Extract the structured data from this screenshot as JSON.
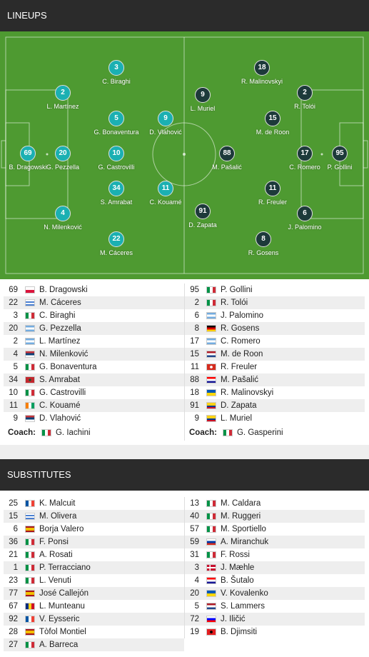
{
  "lineups_header": "LINEUPS",
  "substitutes_header": "SUBSTITUTES",
  "colors": {
    "home": "#1bb0b2",
    "away": "#1d3a3a",
    "pitch": "#4e9a31"
  },
  "pitch_players": [
    {
      "num": "69",
      "name": "B. Dragowski",
      "team": "home"
    },
    {
      "num": "20",
      "name": "G. Pezzella",
      "team": "home"
    },
    {
      "num": "2",
      "name": "L. Martínez",
      "team": "home"
    },
    {
      "num": "4",
      "name": "N. Milenković",
      "team": "home"
    },
    {
      "num": "3",
      "name": "C. Biraghi",
      "team": "home"
    },
    {
      "num": "5",
      "name": "G. Bonaventura",
      "team": "home"
    },
    {
      "num": "10",
      "name": "G. Castrovilli",
      "team": "home"
    },
    {
      "num": "34",
      "name": "S. Amrabat",
      "team": "home"
    },
    {
      "num": "22",
      "name": "M. Cáceres",
      "team": "home"
    },
    {
      "num": "9",
      "name": "D. Vlahović",
      "team": "home"
    },
    {
      "num": "11",
      "name": "C. Kouamé",
      "team": "home"
    },
    {
      "num": "95",
      "name": "P. Gollini",
      "team": "away"
    },
    {
      "num": "17",
      "name": "C. Romero",
      "team": "away"
    },
    {
      "num": "2",
      "name": "R. Tolói",
      "team": "away"
    },
    {
      "num": "6",
      "name": "J. Palomino",
      "team": "away"
    },
    {
      "num": "18",
      "name": "R. Malinovskyi",
      "team": "away"
    },
    {
      "num": "15",
      "name": "M. de Roon",
      "team": "away"
    },
    {
      "num": "11",
      "name": "R. Freuler",
      "team": "away"
    },
    {
      "num": "8",
      "name": "R. Gosens",
      "team": "away"
    },
    {
      "num": "9",
      "name": "L. Muriel",
      "team": "away"
    },
    {
      "num": "88",
      "name": "M. Pašalić",
      "team": "away"
    },
    {
      "num": "91",
      "name": "D. Zapata",
      "team": "away"
    }
  ],
  "home_lineup": [
    {
      "num": "69",
      "name": "B. Dragowski",
      "flag": "poland"
    },
    {
      "num": "22",
      "name": "M. Cáceres",
      "flag": "uruguay"
    },
    {
      "num": "3",
      "name": "C. Biraghi",
      "flag": "italy"
    },
    {
      "num": "20",
      "name": "G. Pezzella",
      "flag": "argentina"
    },
    {
      "num": "2",
      "name": "L. Martínez",
      "flag": "argentina"
    },
    {
      "num": "4",
      "name": "N. Milenković",
      "flag": "serbia"
    },
    {
      "num": "5",
      "name": "G. Bonaventura",
      "flag": "italy"
    },
    {
      "num": "34",
      "name": "S. Amrabat",
      "flag": "morocco"
    },
    {
      "num": "10",
      "name": "G. Castrovilli",
      "flag": "italy"
    },
    {
      "num": "11",
      "name": "C. Kouamé",
      "flag": "ivory-coast"
    },
    {
      "num": "9",
      "name": "D. Vlahović",
      "flag": "serbia"
    }
  ],
  "away_lineup": [
    {
      "num": "95",
      "name": "P. Gollini",
      "flag": "italy"
    },
    {
      "num": "2",
      "name": "R. Tolói",
      "flag": "italy"
    },
    {
      "num": "6",
      "name": "J. Palomino",
      "flag": "argentina"
    },
    {
      "num": "8",
      "name": "R. Gosens",
      "flag": "germany"
    },
    {
      "num": "17",
      "name": "C. Romero",
      "flag": "argentina"
    },
    {
      "num": "15",
      "name": "M. de Roon",
      "flag": "netherlands"
    },
    {
      "num": "11",
      "name": "R. Freuler",
      "flag": "switzerland"
    },
    {
      "num": "88",
      "name": "M. Pašalić",
      "flag": "croatia"
    },
    {
      "num": "18",
      "name": "R. Malinovskyi",
      "flag": "ukraine"
    },
    {
      "num": "91",
      "name": "D. Zapata",
      "flag": "colombia"
    },
    {
      "num": "9",
      "name": "L. Muriel",
      "flag": "colombia"
    }
  ],
  "home_coach": {
    "label": "Coach:",
    "name": "G. Iachini",
    "flag": "italy"
  },
  "away_coach": {
    "label": "Coach:",
    "name": "G. Gasperini",
    "flag": "italy"
  },
  "home_subs": [
    {
      "num": "25",
      "name": "K. Malcuit",
      "flag": "france"
    },
    {
      "num": "15",
      "name": "M. Olivera",
      "flag": "uruguay"
    },
    {
      "num": "6",
      "name": "Borja Valero",
      "flag": "spain"
    },
    {
      "num": "36",
      "name": "F. Ponsi",
      "flag": "italy"
    },
    {
      "num": "21",
      "name": "A. Rosati",
      "flag": "italy"
    },
    {
      "num": "1",
      "name": "P. Terracciano",
      "flag": "italy"
    },
    {
      "num": "23",
      "name": "L. Venuti",
      "flag": "italy"
    },
    {
      "num": "77",
      "name": "José Callejón",
      "flag": "spain"
    },
    {
      "num": "67",
      "name": "L. Munteanu",
      "flag": "romania"
    },
    {
      "num": "92",
      "name": "V. Eysseric",
      "flag": "france"
    },
    {
      "num": "28",
      "name": "Tòfol Montiel",
      "flag": "spain"
    },
    {
      "num": "27",
      "name": "A. Barreca",
      "flag": "italy"
    }
  ],
  "away_subs": [
    {
      "num": "13",
      "name": "M. Caldara",
      "flag": "italy"
    },
    {
      "num": "40",
      "name": "M. Ruggeri",
      "flag": "italy"
    },
    {
      "num": "57",
      "name": "M. Sportiello",
      "flag": "italy"
    },
    {
      "num": "59",
      "name": "A. Miranchuk",
      "flag": "russia"
    },
    {
      "num": "31",
      "name": "F. Rossi",
      "flag": "italy"
    },
    {
      "num": "3",
      "name": "J. Mæhle",
      "flag": "denmark"
    },
    {
      "num": "4",
      "name": "B. Šutalo",
      "flag": "croatia"
    },
    {
      "num": "20",
      "name": "V. Kovalenko",
      "flag": "ukraine"
    },
    {
      "num": "5",
      "name": "S. Lammers",
      "flag": "netherlands"
    },
    {
      "num": "72",
      "name": "J. Iličić",
      "flag": "slovenia"
    },
    {
      "num": "19",
      "name": "B. Djimsiti",
      "flag": "albania"
    }
  ]
}
